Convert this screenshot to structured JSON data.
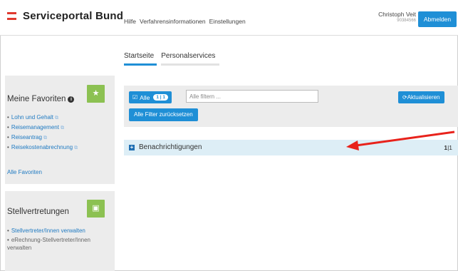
{
  "header": {
    "brand": "Serviceportal Bund",
    "nav": [
      "Hilfe",
      "Verfahrensinformationen",
      "Einstellungen"
    ],
    "user_name": "Christoph Veit",
    "user_id": "90384566",
    "logout_label": "Abmelden"
  },
  "tabs": [
    {
      "label": "Startseite",
      "active": true
    },
    {
      "label": "Personalservices",
      "active": false
    }
  ],
  "favorites": {
    "title": "Meine Favoriten",
    "info_icon": "info-icon",
    "badge_icon": "star-icon",
    "items": [
      "Lohn und Gehalt",
      "Reisemanagement",
      "Reiseantrag",
      "Reisekostenabrechnung"
    ],
    "all_link": "Alle Favoriten"
  },
  "substitutes": {
    "title": "Stellvertretungen",
    "badge_icon": "briefcase-icon",
    "items": [
      "Stellvertreter/Innen verwalten",
      "eRechnung-Stellvertreter/Innen verwalten"
    ]
  },
  "filter": {
    "all_label": "Alle",
    "all_count": "1 | 1",
    "input_placeholder": "Alle filtern ...",
    "reset_label": "Alle Filter zurücksetzen",
    "refresh_label": "Aktualisieren"
  },
  "notifications": {
    "label": "Benachrichtigungen",
    "count_bold": "1",
    "count_rest": "|1"
  },
  "colors": {
    "primary": "#1f8fd6",
    "badge_green": "#8cc152",
    "brand_red": "#e03a2f",
    "annotation_red": "#e8221b"
  }
}
